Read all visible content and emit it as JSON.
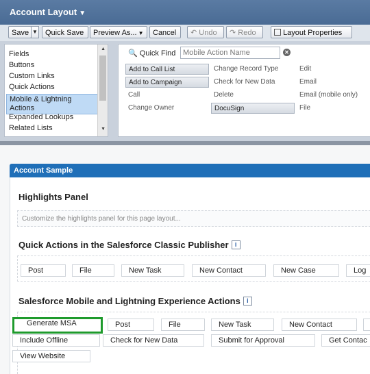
{
  "header": {
    "title": "Account Layout"
  },
  "toolbar": {
    "save": "Save",
    "quick_save": "Quick Save",
    "preview_as": "Preview As...",
    "cancel": "Cancel",
    "undo": "Undo",
    "redo": "Redo",
    "layout_properties": "Layout Properties"
  },
  "palette": {
    "categories": [
      "Fields",
      "Buttons",
      "Custom Links",
      "Quick Actions",
      "Mobile & Lightning Actions",
      "Expanded Lookups",
      "Related Lists"
    ],
    "selected_category": "Mobile & Lightning Actions",
    "quick_find_label": "Quick Find",
    "quick_find_placeholder": "Mobile Action Name",
    "items": [
      [
        "Add to Call List",
        "Change Record Type",
        "Edit"
      ],
      [
        "Add to Campaign",
        "Check for New Data",
        "Email"
      ],
      [
        "Call",
        "Delete",
        "Email (mobile only)"
      ],
      [
        "Change Owner",
        "DocuSign",
        "File"
      ]
    ]
  },
  "canvas": {
    "sample_title": "Account Sample",
    "highlights_title": "Highlights Panel",
    "highlights_placeholder": "Customize the highlights panel for this page layout...",
    "classic_title": "Quick Actions in the Salesforce Classic Publisher",
    "classic_actions": [
      "Post",
      "File",
      "New Task",
      "New Contact",
      "New Case",
      "Log"
    ],
    "lightning_title": "Salesforce Mobile and Lightning Experience Actions",
    "lightning_row1": [
      "Generate MSA",
      "Post",
      "File",
      "New Task",
      "New Contact"
    ],
    "lightning_row2": [
      "Include Offline",
      "Check for New Data",
      "Submit for Approval",
      "Get Contac"
    ],
    "lightning_row3": [
      "View Website"
    ],
    "info_icon_glyph": "i"
  },
  "colors": {
    "highlight": "#1e9a2c",
    "sample_bar": "#1f6fb8",
    "header": "#4a6b94"
  }
}
